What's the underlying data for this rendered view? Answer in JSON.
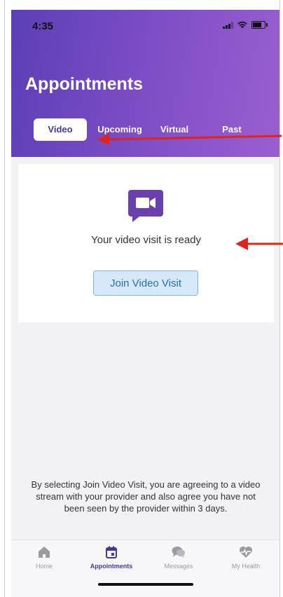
{
  "status_bar": {
    "time": "4:35"
  },
  "header": {
    "title": "Appointments",
    "tabs": [
      {
        "label": "Video",
        "active": true
      },
      {
        "label": "Upcoming",
        "active": false
      },
      {
        "label": "Virtual",
        "active": false
      },
      {
        "label": "Past",
        "active": false
      }
    ]
  },
  "video_card": {
    "icon": "video-camera-icon",
    "message": "Your video visit is ready",
    "button_label": "Join Video Visit"
  },
  "disclaimer": "By selecting Join Video Visit, you are agreeing to a video stream with your provider and also agree you have not been seen by the provider within 3 days.",
  "tab_bar": [
    {
      "label": "Home",
      "icon": "home-icon",
      "active": false
    },
    {
      "label": "Appointments",
      "icon": "calendar-icon",
      "active": true
    },
    {
      "label": "Messages",
      "icon": "messages-icon",
      "active": false
    },
    {
      "label": "My Health",
      "icon": "heart-icon",
      "active": false
    }
  ],
  "colors": {
    "header_gradient_start": "#5b3fb6",
    "header_gradient_end": "#9a5fd0",
    "accent": "#4a35a6",
    "button_bg": "#d6e9fb",
    "button_text": "#2a6fb3",
    "annotation_arrow": "#e0241b"
  }
}
